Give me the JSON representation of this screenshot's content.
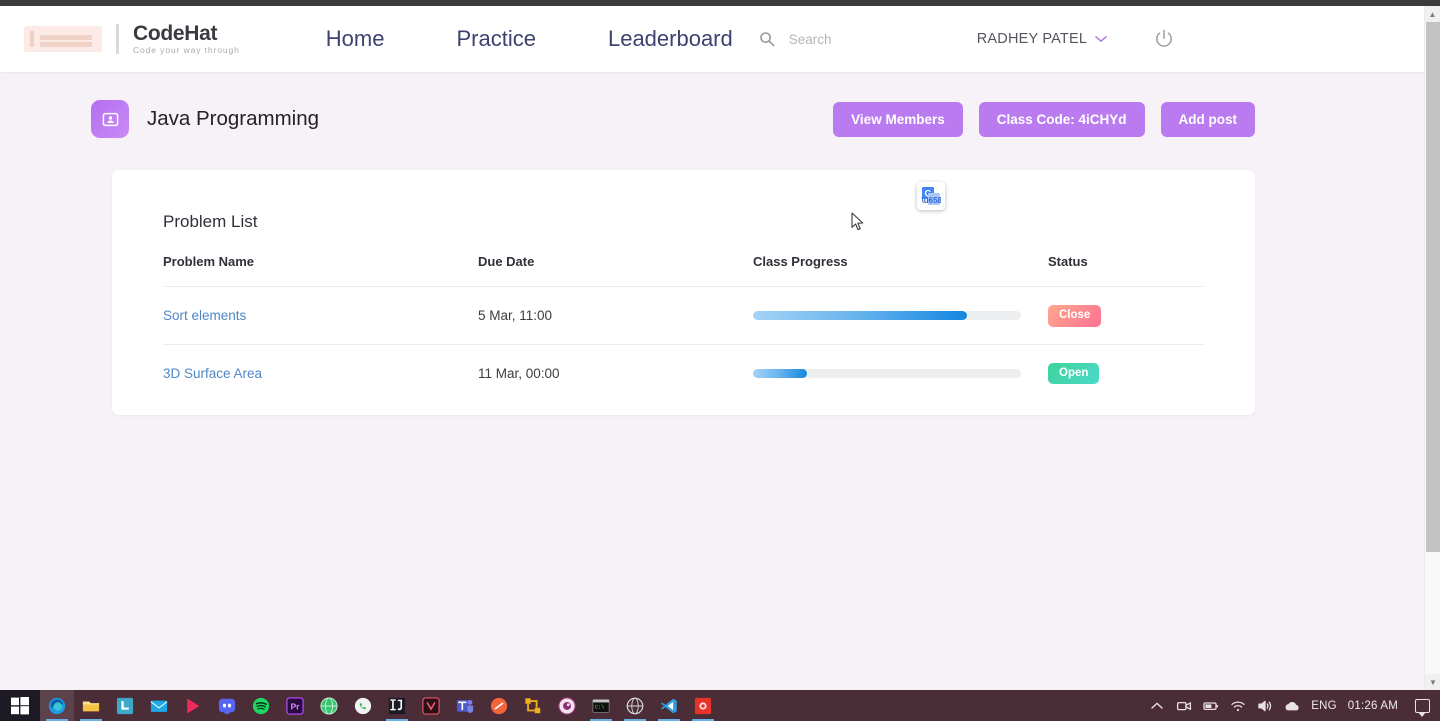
{
  "browser": {
    "scrollbar": {
      "up_arrow": "▲",
      "down_arrow": "▼"
    }
  },
  "header": {
    "brand": {
      "name": "CodeHat",
      "tagline": "Code your way through",
      "logo_icon": "codehat-logo-icon"
    },
    "nav": [
      {
        "label": "Home",
        "name": "nav-home"
      },
      {
        "label": "Practice",
        "name": "nav-practice"
      },
      {
        "label": "Leaderboard",
        "name": "nav-leaderboard"
      }
    ],
    "search": {
      "placeholder": "Search",
      "value": "",
      "icon": "search-icon"
    },
    "user": {
      "name": "RADHEY PATEL",
      "chevron": "⌄",
      "icon": "chevron-down-icon"
    },
    "power": {
      "icon": "power-icon",
      "label": "Logout"
    }
  },
  "page": {
    "class_icon": "class-card-icon",
    "title": "Java Programming",
    "actions": [
      {
        "label": "View Members",
        "name": "view-members-button"
      },
      {
        "label": "Class Code: 4iCHYd",
        "name": "class-code-button"
      },
      {
        "label": "Add post",
        "name": "add-post-button"
      }
    ]
  },
  "card": {
    "title": "Problem List",
    "translate_icon": "google-translate-icon",
    "columns": [
      "Problem Name",
      "Due Date",
      "Class Progress",
      "Status"
    ],
    "rows": [
      {
        "name": "Sort elements",
        "due_date": "5 Mar, 11:00",
        "progress": 80,
        "status": "Close",
        "status_kind": "close"
      },
      {
        "name": "3D Surface Area",
        "due_date": "11 Mar, 00:00",
        "progress": 20,
        "status": "Open",
        "status_kind": "open"
      }
    ]
  },
  "taskbar": {
    "start": {
      "icon": "windows-start-icon"
    },
    "items": [
      {
        "name": "taskbar-edge",
        "icon": "edge-icon"
      },
      {
        "name": "taskbar-file-explorer",
        "icon": "file-explorer-icon"
      },
      {
        "name": "taskbar-lightshot",
        "icon": "lightshot-icon"
      },
      {
        "name": "taskbar-mail",
        "icon": "mail-icon"
      },
      {
        "name": "taskbar-play",
        "icon": "play-store-icon"
      },
      {
        "name": "taskbar-discord",
        "icon": "discord-icon"
      },
      {
        "name": "taskbar-spotify",
        "icon": "spotify-icon"
      },
      {
        "name": "taskbar-premiere",
        "icon": "premiere-pro-icon"
      },
      {
        "name": "taskbar-globe",
        "icon": "globe-icon"
      },
      {
        "name": "taskbar-whatsapp",
        "icon": "whatsapp-icon"
      },
      {
        "name": "taskbar-intellij",
        "icon": "intellij-icon"
      },
      {
        "name": "taskbar-vivaldi",
        "icon": "vivaldi-icon"
      },
      {
        "name": "taskbar-teams",
        "icon": "ms-teams-icon"
      },
      {
        "name": "taskbar-orange-app",
        "icon": "orange-app-icon"
      },
      {
        "name": "taskbar-yellow-app",
        "icon": "yellow-network-icon"
      },
      {
        "name": "taskbar-camera",
        "icon": "camera-disc-icon"
      },
      {
        "name": "taskbar-terminal",
        "icon": "terminal-icon"
      },
      {
        "name": "taskbar-browser-alt",
        "icon": "alt-browser-icon"
      },
      {
        "name": "taskbar-vscode",
        "icon": "vscode-icon"
      },
      {
        "name": "taskbar-red-app",
        "icon": "red-app-icon"
      }
    ],
    "tray": {
      "chevron": "⌃",
      "icons": [
        "camera-tray-icon",
        "battery-icon",
        "wifi-icon",
        "volume-icon",
        "onedrive-icon"
      ],
      "language": "ENG",
      "time": "01:26 AM",
      "notification": "notification-icon"
    }
  },
  "colors": {
    "accent_purple": "#bb7bf0",
    "nav_text": "#3d4270",
    "page_bg": "#f7f1f8",
    "progress_start": "#a4d3f5",
    "progress_end": "#1487e0",
    "badge_close": "#fb7293",
    "badge_open": "#3fd39a",
    "link_blue": "#4f86c6"
  }
}
